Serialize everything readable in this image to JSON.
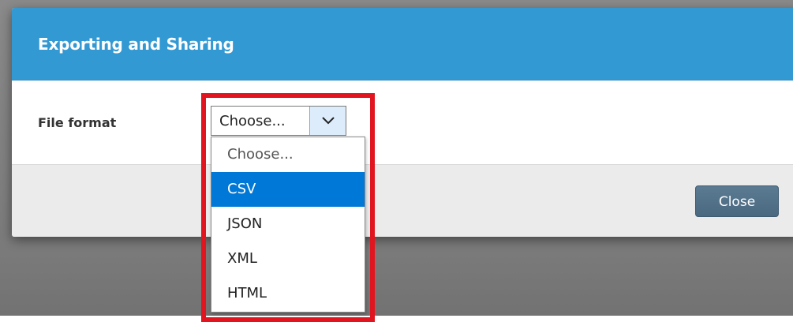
{
  "modal": {
    "title": "Exporting and Sharing",
    "field_label": "File format",
    "close_label": "Close"
  },
  "select": {
    "value": "Choose...",
    "options": [
      {
        "label": "Choose...",
        "selected": false
      },
      {
        "label": "CSV",
        "selected": true
      },
      {
        "label": "JSON",
        "selected": false
      },
      {
        "label": "XML",
        "selected": false
      },
      {
        "label": "HTML",
        "selected": false
      }
    ]
  },
  "colors": {
    "header": "#3399d3",
    "selection": "#0078d7",
    "highlight": "#e0151f",
    "close_button": "#4f6e86"
  },
  "icons": {
    "select_arrow": "chevron-down-icon"
  }
}
